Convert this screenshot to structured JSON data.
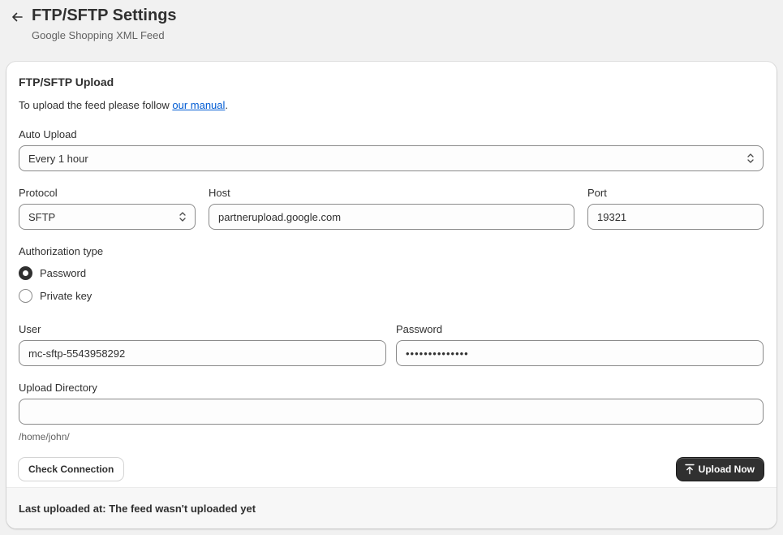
{
  "header": {
    "title": "FTP/SFTP Settings",
    "subtitle": "Google Shopping XML Feed"
  },
  "card": {
    "title": "FTP/SFTP Upload",
    "intro_prefix": "To upload the feed please follow ",
    "intro_link": "our manual",
    "intro_suffix": "."
  },
  "form": {
    "auto_upload": {
      "label": "Auto Upload",
      "value": "Every 1 hour"
    },
    "protocol": {
      "label": "Protocol",
      "value": "SFTP"
    },
    "host": {
      "label": "Host",
      "value": "partnerupload.google.com"
    },
    "port": {
      "label": "Port",
      "value": "19321"
    },
    "auth_type": {
      "label": "Authorization type",
      "options": [
        {
          "label": "Password",
          "checked": true
        },
        {
          "label": "Private key",
          "checked": false
        }
      ]
    },
    "user": {
      "label": "User",
      "value": "mc-sftp-5543958292"
    },
    "password": {
      "label": "Password",
      "value": "••••••••••••••"
    },
    "upload_directory": {
      "label": "Upload Directory",
      "value": "",
      "help": "/home/john/"
    }
  },
  "actions": {
    "check_connection": "Check Connection",
    "upload_now": "Upload Now"
  },
  "footer": {
    "last_uploaded": "Last uploaded at: The feed wasn't uploaded yet"
  },
  "icons": {
    "back": "arrow-left-icon",
    "select": "chevron-up-down-icon",
    "upload": "upload-arrow-icon"
  }
}
